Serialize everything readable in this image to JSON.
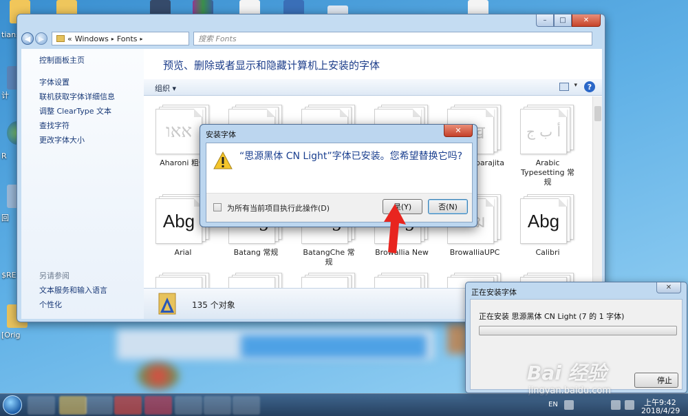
{
  "desktop": {
    "labels": [
      "tians",
      "计",
      "R",
      "回",
      "$REC",
      "[Orig"
    ]
  },
  "explorer": {
    "address_parts": [
      "«",
      "Windows",
      "▸",
      "Fonts",
      "▸"
    ],
    "search_placeholder": "搜索 Fonts",
    "nav_links": [
      "控制面板主页",
      "字体设置",
      "联机获取字体详细信息",
      "调整 ClearType 文本",
      "查找字符",
      "更改字体大小"
    ],
    "see_also_header": "另请参阅",
    "see_also_links": [
      "文本服务和输入语言",
      "个性化"
    ],
    "content_title": "预览、删除或者显示和隐藏计算机上安装的字体",
    "organize_label": "组织 ▾",
    "help_label": "?",
    "status_count": "135 个对象",
    "fonts": [
      {
        "label": "Aharoni 粗体",
        "glyph": "אאו",
        "faint": true
      },
      {
        "label": "Aparajita",
        "glyph": "कख",
        "faint": true
      },
      {
        "label": "Arabic Typesetting 常规",
        "glyph": "أ ب ج",
        "faint": true
      },
      {
        "label": "Arial",
        "glyph": "Abg",
        "faint": false
      },
      {
        "label": "Batang 常规",
        "glyph": "Abg",
        "faint": false
      },
      {
        "label": "BatangChe 常规",
        "glyph": "Abg",
        "faint": false
      },
      {
        "label": "Browallia New",
        "glyph": "Abg",
        "faint": false
      },
      {
        "label": "BrowalliaUPC",
        "glyph": "ฒฆ",
        "faint": true
      },
      {
        "label": "Calibri",
        "glyph": "Abg",
        "faint": false
      }
    ]
  },
  "dialog": {
    "title": "安装字体",
    "message": "“思源黑体 CN Light”字体已安装。您希望替换它吗?",
    "checkbox_label": "为所有当前项目执行此操作(D)",
    "yes_label": "是(Y)",
    "no_label": "否(N)"
  },
  "progress": {
    "title": "正在安装字体",
    "status": "正在安装 思源黑体 CN Light (7 的 1 字体)",
    "stop_label": "停止",
    "fraction": 0.0
  },
  "watermark": {
    "text": "Bai 经验",
    "sub": "jingyan.baidu.com"
  },
  "taskbar": {
    "lang": "EN",
    "time": "上午9:42",
    "date": "2018/4/29"
  }
}
